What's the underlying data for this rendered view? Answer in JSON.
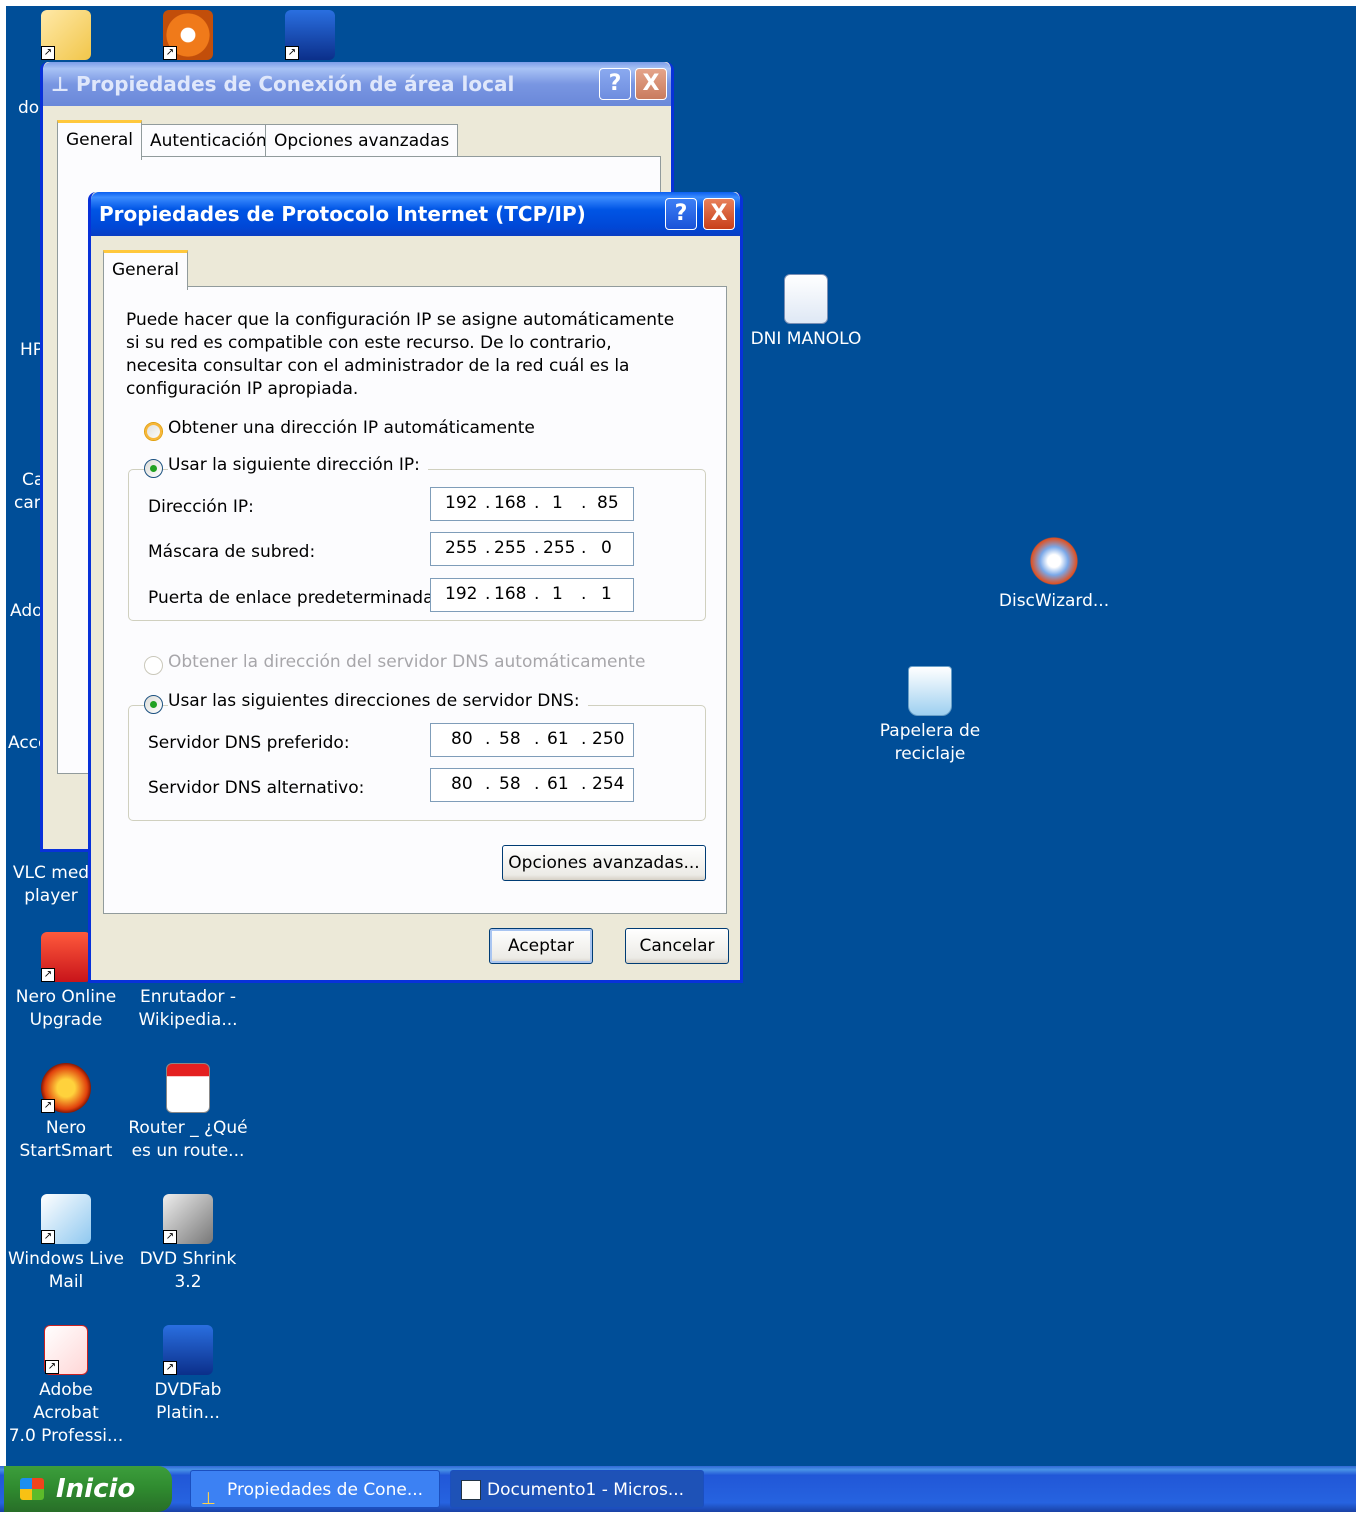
{
  "desktop": {
    "icons": {
      "doc_partial": "do",
      "hp_partial": "HP",
      "ca_partial_1": "Ca",
      "ca_partial_2": "car",
      "adobe_partial": "Ado",
      "acc_partial": "Acce",
      "vlc": "VLC med\nplayer",
      "nero_online": "Nero Online\nUpgrade",
      "enrutador": "Enrutador -\nWikipedia...",
      "nero_startsmart": "Nero\nStartSmart",
      "router_pdf": "Router _ ¿Qué\nes un route...",
      "windows_live_mail": "Windows Live\nMail",
      "dvd_shrink": "DVD Shrink 3.2",
      "adobe_acrobat": "Adobe Acrobat\n7.0 Professi...",
      "dvdfab": "DVDFab\nPlatin...",
      "dni_manolo": "DNI MANOLO",
      "discwizard": "DiscWizard...",
      "papelera": "Papelera de\nreciclaje"
    }
  },
  "back_window": {
    "title": "Propiedades de Conexión de área local",
    "tabs": [
      "General",
      "Autenticación",
      "Opciones avanzadas"
    ]
  },
  "dialog": {
    "title": "Propiedades de Protocolo Internet (TCP/IP)",
    "tab": "General",
    "description": "Puede hacer que la configuración IP se asigne automáticamente si su red es compatible con este recurso. De lo contrario, necesita consultar con el administrador de la red cuál es la configuración IP apropiada.",
    "auto_ip_label": "Obtener una dirección IP automáticamente",
    "manual_ip_label": "Usar la siguiente dirección IP:",
    "ip_label": "Dirección IP:",
    "ip_value": [
      "192",
      "168",
      "1",
      "85"
    ],
    "mask_label": "Máscara de subred:",
    "mask_value": [
      "255",
      "255",
      "255",
      "0"
    ],
    "gateway_label": "Puerta de enlace predeterminada:",
    "gateway_value": [
      "192",
      "168",
      "1",
      "1"
    ],
    "auto_dns_label": "Obtener la dirección del servidor DNS automáticamente",
    "manual_dns_label": "Usar las siguientes direcciones de servidor DNS:",
    "dns_pref_label": "Servidor DNS preferido:",
    "dns_pref_value": [
      "80",
      "58",
      "61",
      "250"
    ],
    "dns_alt_label": "Servidor DNS alternativo:",
    "dns_alt_value": [
      "80",
      "58",
      "61",
      "254"
    ],
    "advanced_button": "Opciones avanzadas...",
    "ok_button": "Aceptar",
    "cancel_button": "Cancelar",
    "help_glyph": "?",
    "close_glyph": "X"
  },
  "taskbar": {
    "start_label": "Inicio",
    "tasks": [
      "Propiedades de Cone...",
      "Documento1 - Micros..."
    ]
  },
  "colors": {
    "desktop": "#004e98",
    "titlebar": "#0055e5",
    "dialog_bg": "#ece9d8",
    "taskbar": "#2663e0",
    "start_button": "#2f8a2f"
  }
}
